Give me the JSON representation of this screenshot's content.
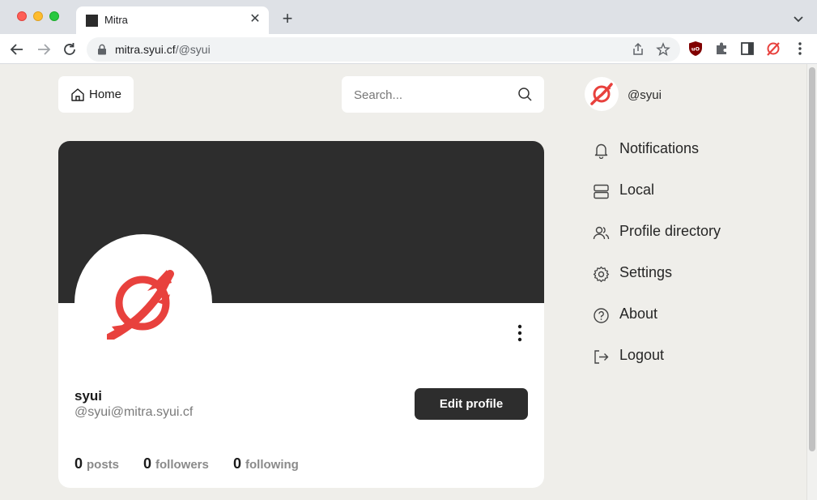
{
  "browser": {
    "tab_title": "Mitra",
    "url_host": "mitra.syui.cf",
    "url_path": "/@syui",
    "icons": [
      "back-icon",
      "forward-icon",
      "reload-icon",
      "lock-icon",
      "share-icon",
      "star-icon",
      "ublock-icon",
      "puzzle-icon",
      "side-panel-icon",
      "mitra-extension-icon",
      "menu-icon"
    ]
  },
  "header": {
    "home_label": "Home",
    "search_placeholder": "Search...",
    "user_handle": "@syui"
  },
  "sidebar": {
    "items": [
      {
        "label": "Notifications",
        "icon": "bell-icon"
      },
      {
        "label": "Local",
        "icon": "server-icon"
      },
      {
        "label": "Profile directory",
        "icon": "users-icon"
      },
      {
        "label": "Settings",
        "icon": "gear-icon"
      },
      {
        "label": "About",
        "icon": "question-icon"
      },
      {
        "label": "Logout",
        "icon": "logout-icon"
      }
    ]
  },
  "profile": {
    "display_name": "syui",
    "acct": "@syui@mitra.syui.cf",
    "edit_label": "Edit profile",
    "stats": [
      {
        "count": "0",
        "label": "posts"
      },
      {
        "count": "0",
        "label": "followers"
      },
      {
        "count": "0",
        "label": "following"
      }
    ]
  },
  "colors": {
    "background": "#efeeea",
    "cover": "#2d2d2d",
    "brand_red": "#e8413d",
    "button_dark": "#2d2d2d"
  }
}
